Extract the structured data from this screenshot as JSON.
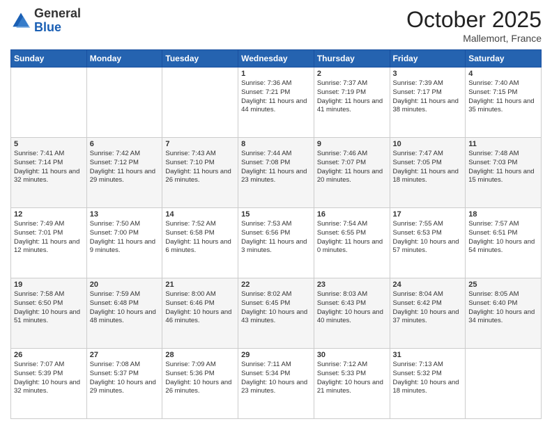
{
  "header": {
    "logo_general": "General",
    "logo_blue": "Blue",
    "month": "October 2025",
    "location": "Mallemort, France"
  },
  "columns": [
    "Sunday",
    "Monday",
    "Tuesday",
    "Wednesday",
    "Thursday",
    "Friday",
    "Saturday"
  ],
  "weeks": [
    [
      {
        "day": "",
        "content": ""
      },
      {
        "day": "",
        "content": ""
      },
      {
        "day": "",
        "content": ""
      },
      {
        "day": "1",
        "content": "Sunrise: 7:36 AM\nSunset: 7:21 PM\nDaylight: 11 hours\nand 44 minutes."
      },
      {
        "day": "2",
        "content": "Sunrise: 7:37 AM\nSunset: 7:19 PM\nDaylight: 11 hours\nand 41 minutes."
      },
      {
        "day": "3",
        "content": "Sunrise: 7:39 AM\nSunset: 7:17 PM\nDaylight: 11 hours\nand 38 minutes."
      },
      {
        "day": "4",
        "content": "Sunrise: 7:40 AM\nSunset: 7:15 PM\nDaylight: 11 hours\nand 35 minutes."
      }
    ],
    [
      {
        "day": "5",
        "content": "Sunrise: 7:41 AM\nSunset: 7:14 PM\nDaylight: 11 hours\nand 32 minutes."
      },
      {
        "day": "6",
        "content": "Sunrise: 7:42 AM\nSunset: 7:12 PM\nDaylight: 11 hours\nand 29 minutes."
      },
      {
        "day": "7",
        "content": "Sunrise: 7:43 AM\nSunset: 7:10 PM\nDaylight: 11 hours\nand 26 minutes."
      },
      {
        "day": "8",
        "content": "Sunrise: 7:44 AM\nSunset: 7:08 PM\nDaylight: 11 hours\nand 23 minutes."
      },
      {
        "day": "9",
        "content": "Sunrise: 7:46 AM\nSunset: 7:07 PM\nDaylight: 11 hours\nand 20 minutes."
      },
      {
        "day": "10",
        "content": "Sunrise: 7:47 AM\nSunset: 7:05 PM\nDaylight: 11 hours\nand 18 minutes."
      },
      {
        "day": "11",
        "content": "Sunrise: 7:48 AM\nSunset: 7:03 PM\nDaylight: 11 hours\nand 15 minutes."
      }
    ],
    [
      {
        "day": "12",
        "content": "Sunrise: 7:49 AM\nSunset: 7:01 PM\nDaylight: 11 hours\nand 12 minutes."
      },
      {
        "day": "13",
        "content": "Sunrise: 7:50 AM\nSunset: 7:00 PM\nDaylight: 11 hours\nand 9 minutes."
      },
      {
        "day": "14",
        "content": "Sunrise: 7:52 AM\nSunset: 6:58 PM\nDaylight: 11 hours\nand 6 minutes."
      },
      {
        "day": "15",
        "content": "Sunrise: 7:53 AM\nSunset: 6:56 PM\nDaylight: 11 hours\nand 3 minutes."
      },
      {
        "day": "16",
        "content": "Sunrise: 7:54 AM\nSunset: 6:55 PM\nDaylight: 11 hours\nand 0 minutes."
      },
      {
        "day": "17",
        "content": "Sunrise: 7:55 AM\nSunset: 6:53 PM\nDaylight: 10 hours\nand 57 minutes."
      },
      {
        "day": "18",
        "content": "Sunrise: 7:57 AM\nSunset: 6:51 PM\nDaylight: 10 hours\nand 54 minutes."
      }
    ],
    [
      {
        "day": "19",
        "content": "Sunrise: 7:58 AM\nSunset: 6:50 PM\nDaylight: 10 hours\nand 51 minutes."
      },
      {
        "day": "20",
        "content": "Sunrise: 7:59 AM\nSunset: 6:48 PM\nDaylight: 10 hours\nand 48 minutes."
      },
      {
        "day": "21",
        "content": "Sunrise: 8:00 AM\nSunset: 6:46 PM\nDaylight: 10 hours\nand 46 minutes."
      },
      {
        "day": "22",
        "content": "Sunrise: 8:02 AM\nSunset: 6:45 PM\nDaylight: 10 hours\nand 43 minutes."
      },
      {
        "day": "23",
        "content": "Sunrise: 8:03 AM\nSunset: 6:43 PM\nDaylight: 10 hours\nand 40 minutes."
      },
      {
        "day": "24",
        "content": "Sunrise: 8:04 AM\nSunset: 6:42 PM\nDaylight: 10 hours\nand 37 minutes."
      },
      {
        "day": "25",
        "content": "Sunrise: 8:05 AM\nSunset: 6:40 PM\nDaylight: 10 hours\nand 34 minutes."
      }
    ],
    [
      {
        "day": "26",
        "content": "Sunrise: 7:07 AM\nSunset: 5:39 PM\nDaylight: 10 hours\nand 32 minutes."
      },
      {
        "day": "27",
        "content": "Sunrise: 7:08 AM\nSunset: 5:37 PM\nDaylight: 10 hours\nand 29 minutes."
      },
      {
        "day": "28",
        "content": "Sunrise: 7:09 AM\nSunset: 5:36 PM\nDaylight: 10 hours\nand 26 minutes."
      },
      {
        "day": "29",
        "content": "Sunrise: 7:11 AM\nSunset: 5:34 PM\nDaylight: 10 hours\nand 23 minutes."
      },
      {
        "day": "30",
        "content": "Sunrise: 7:12 AM\nSunset: 5:33 PM\nDaylight: 10 hours\nand 21 minutes."
      },
      {
        "day": "31",
        "content": "Sunrise: 7:13 AM\nSunset: 5:32 PM\nDaylight: 10 hours\nand 18 minutes."
      },
      {
        "day": "",
        "content": ""
      }
    ]
  ]
}
